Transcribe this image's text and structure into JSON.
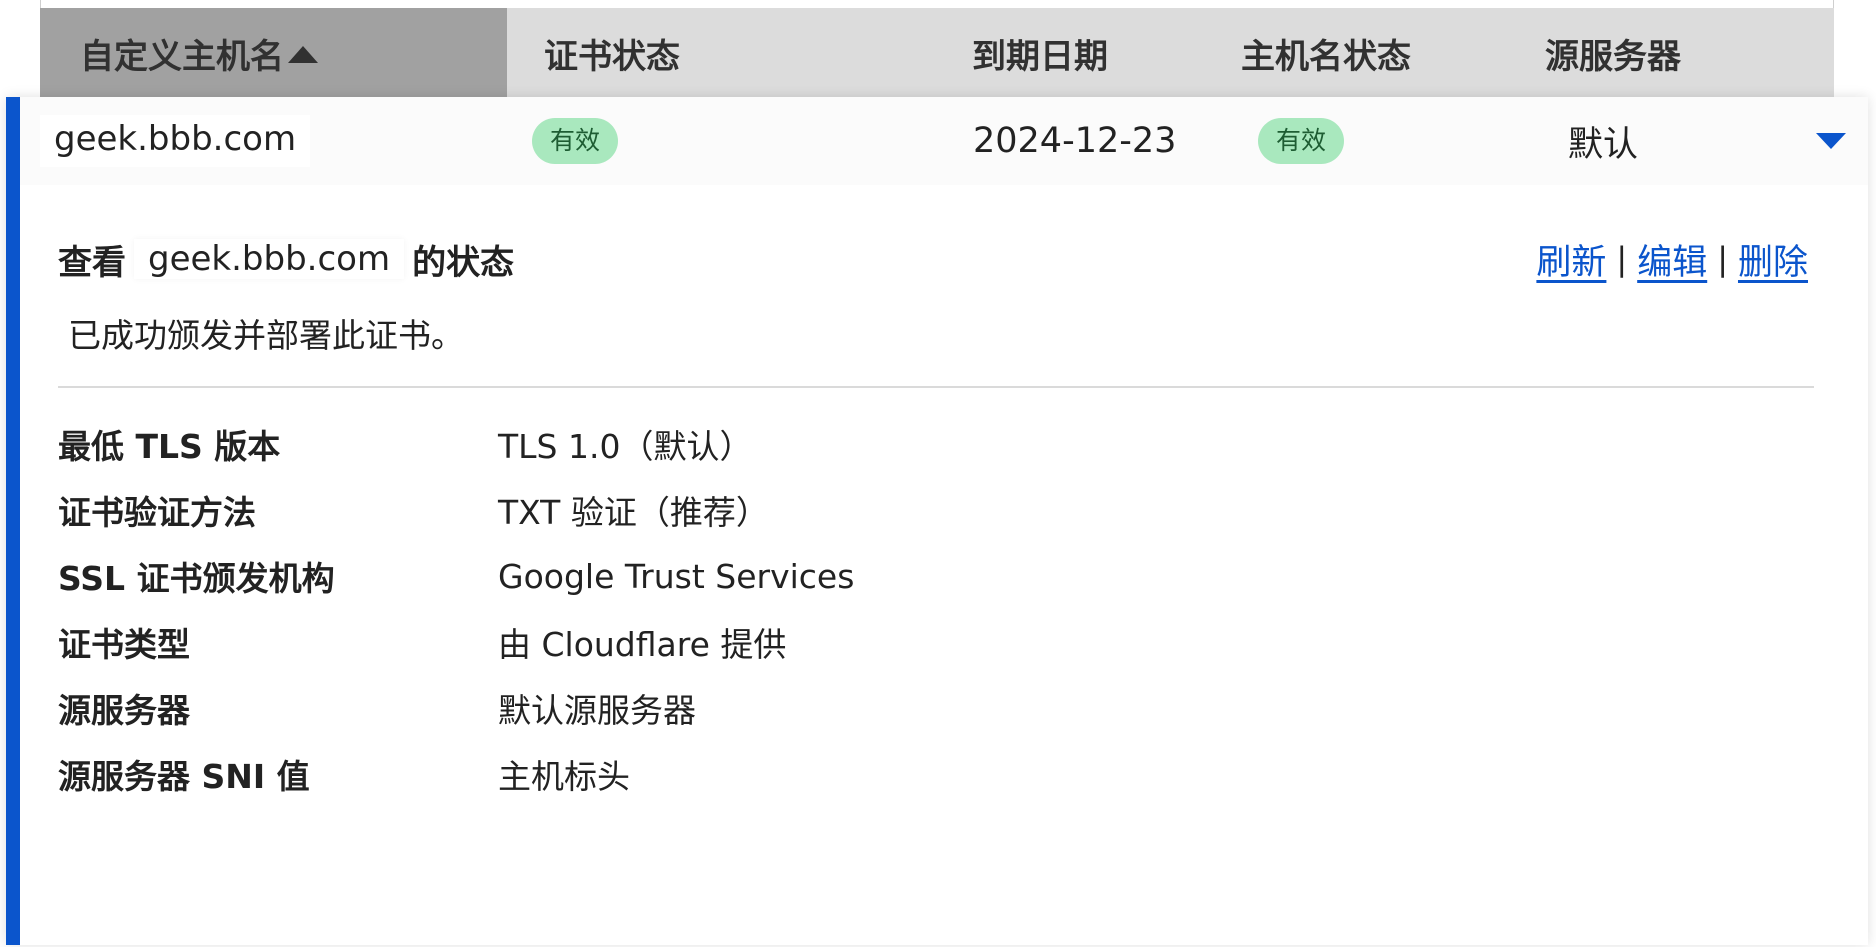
{
  "table": {
    "columns": [
      {
        "label": "自定义主机名",
        "sorted": "ascending"
      },
      {
        "label": "证书状态"
      },
      {
        "label": "到期日期"
      },
      {
        "label": "主机名状态"
      },
      {
        "label": "源服务器"
      }
    ]
  },
  "row": {
    "hostname": "geek.bbb.com",
    "cert_status": "有效",
    "expiry": "2024-12-23",
    "hostname_status": "有效",
    "origin": "默认",
    "expanded": true
  },
  "details": {
    "title_prefix": "查看",
    "hostname": "geek.bbb.com",
    "title_suffix": "的状态",
    "actions": {
      "refresh": "刷新",
      "edit": "编辑",
      "delete": "删除",
      "separator": "|"
    },
    "status_message": "已成功颁发并部署此证书。",
    "properties": [
      {
        "label": "最低 TLS 版本",
        "value": "TLS 1.0（默认）"
      },
      {
        "label": "证书验证方法",
        "value": "TXT 验证（推荐）"
      },
      {
        "label": "SSL 证书颁发机构",
        "value": "Google Trust Services"
      },
      {
        "label": "证书类型",
        "value": "由 Cloudflare 提供"
      },
      {
        "label": "源服务器",
        "value": "默认源服务器"
      },
      {
        "label": "源服务器 SNI 值",
        "value": "主机标头"
      }
    ]
  },
  "colors": {
    "accent": "#0b55cc",
    "badge_bg": "#a9e8be",
    "badge_text": "#1e5d33",
    "header_bg": "#dcdcdc",
    "sorted_header_bg": "#a1a1a1"
  },
  "icons": {
    "sort": "sort-ascending-icon",
    "expand": "chevron-down-icon"
  }
}
